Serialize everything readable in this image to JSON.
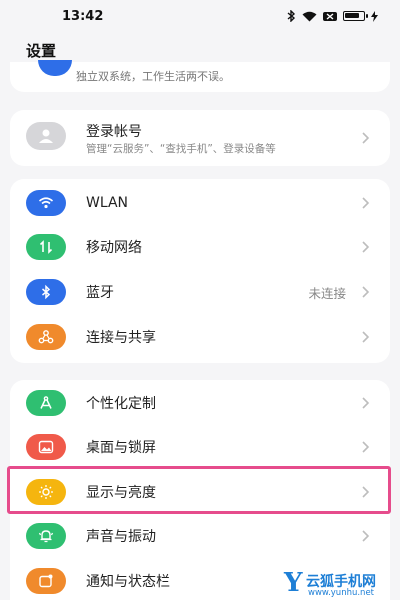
{
  "status_bar": {
    "time": "13:42",
    "battery_level": 0.85
  },
  "page_title": "设置",
  "top_card": {
    "text": "独立双系统，工作生活两不误。"
  },
  "account": {
    "title": "登录帐号",
    "subtitle": "管理“云服务”、“查找手机”、登录设备等"
  },
  "network": {
    "items": [
      {
        "label": "WLAN",
        "icon": "wifi-icon",
        "color": "#2e6ee8"
      },
      {
        "label": "移动网络",
        "icon": "mobile-data-icon",
        "color": "#2fbf71"
      },
      {
        "label": "蓝牙",
        "icon": "bluetooth-icon",
        "color": "#2e6ee8",
        "value": "未连接"
      },
      {
        "label": "连接与共享",
        "icon": "share-icon",
        "color": "#f08a2c"
      }
    ]
  },
  "personal": {
    "items": [
      {
        "label": "个性化定制",
        "icon": "personalize-icon",
        "color": "#2fbf71"
      },
      {
        "label": "桌面与锁屏",
        "icon": "wallpaper-icon",
        "color": "#f05a4a"
      },
      {
        "label": "显示与亮度",
        "icon": "brightness-icon",
        "color": "#f5b50f"
      },
      {
        "label": "声音与振动",
        "icon": "bell-icon",
        "color": "#2fbf71"
      },
      {
        "label": "通知与状态栏",
        "icon": "notification-icon",
        "color": "#f08a2c"
      }
    ]
  },
  "watermark": {
    "mark": "Y",
    "name": "云狐手机网",
    "url": "www.yunhu.net"
  }
}
